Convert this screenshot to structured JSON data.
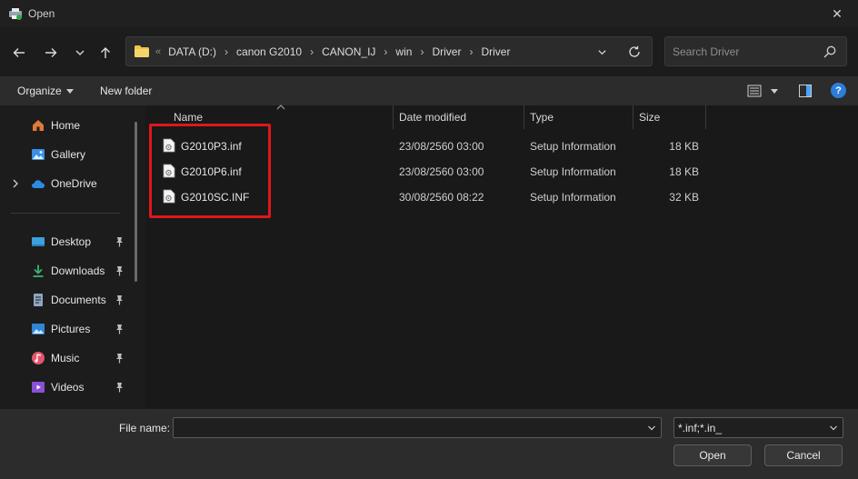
{
  "window": {
    "title": "Open",
    "close_glyph": "✕"
  },
  "nav": {
    "back_icon": "arrow-left-icon",
    "forward_icon": "arrow-right-icon",
    "recent_icon": "chevron-down-icon",
    "up_icon": "arrow-up-icon"
  },
  "address": {
    "overflow": "«",
    "crumbs": [
      "DATA (D:)",
      "canon G2010",
      "CANON_IJ",
      "win",
      "Driver",
      "Driver"
    ],
    "separator": "›"
  },
  "search": {
    "placeholder": "Search Driver",
    "value": ""
  },
  "toolbar": {
    "organize_label": "Organize",
    "new_folder_label": "New folder",
    "help_glyph": "?"
  },
  "sidebar": {
    "items": [
      {
        "label": "Home",
        "icon": "home-icon",
        "pinned": false,
        "expandable": false
      },
      {
        "label": "Gallery",
        "icon": "gallery-icon",
        "pinned": false,
        "expandable": false
      },
      {
        "label": "OneDrive",
        "icon": "cloud-icon",
        "pinned": false,
        "expandable": true
      },
      {
        "label": "Desktop",
        "icon": "desktop-icon",
        "pinned": true,
        "expandable": false
      },
      {
        "label": "Downloads",
        "icon": "download-icon",
        "pinned": true,
        "expandable": false
      },
      {
        "label": "Documents",
        "icon": "document-icon",
        "pinned": true,
        "expandable": false
      },
      {
        "label": "Pictures",
        "icon": "pictures-icon",
        "pinned": true,
        "expandable": false
      },
      {
        "label": "Music",
        "icon": "music-icon",
        "pinned": true,
        "expandable": false
      },
      {
        "label": "Videos",
        "icon": "videos-icon",
        "pinned": true,
        "expandable": false
      }
    ]
  },
  "columns": {
    "name": "Name",
    "date": "Date modified",
    "type": "Type",
    "size": "Size"
  },
  "files": [
    {
      "name": "G2010P3.inf",
      "date": "23/08/2560 03:00",
      "type": "Setup Information",
      "size": "18 KB"
    },
    {
      "name": "G2010P6.inf",
      "date": "23/08/2560 03:00",
      "type": "Setup Information",
      "size": "18 KB"
    },
    {
      "name": "G2010SC.INF",
      "date": "30/08/2560 08:22",
      "type": "Setup Information",
      "size": "32 KB"
    }
  ],
  "footer": {
    "file_name_label": "File name:",
    "file_name_value": "",
    "filter_value": "*.inf;*.in_",
    "open_label": "Open",
    "cancel_label": "Cancel"
  },
  "colors": {
    "highlight": "#e0161b",
    "accent": "#2d7ddb",
    "background": "#1c1c1c"
  }
}
